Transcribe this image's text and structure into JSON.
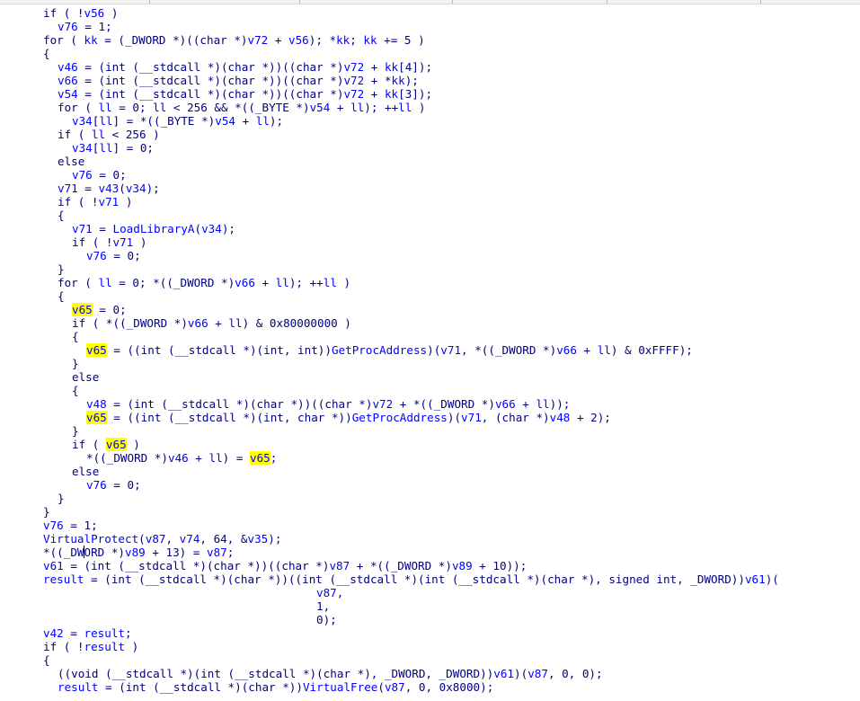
{
  "editor": {
    "lines": [
      [
        {
          "t": "if ( !",
          "c": "k"
        },
        {
          "t": "v56",
          "c": "v"
        },
        {
          "t": " )",
          "c": "s"
        }
      ],
      [
        {
          "t": "v76",
          "c": "v"
        },
        {
          "t": " = 1;",
          "c": "s"
        }
      ],
      [
        {
          "t": "for ( ",
          "c": "k"
        },
        {
          "t": "kk",
          "c": "v"
        },
        {
          "t": " = (_DWORD *)((char *)",
          "c": "s"
        },
        {
          "t": "v72",
          "c": "v"
        },
        {
          "t": " + ",
          "c": "s"
        },
        {
          "t": "v56",
          "c": "v"
        },
        {
          "t": "); *",
          "c": "s"
        },
        {
          "t": "kk",
          "c": "v"
        },
        {
          "t": "; ",
          "c": "s"
        },
        {
          "t": "kk",
          "c": "v"
        },
        {
          "t": " += 5 )",
          "c": "s"
        }
      ],
      [
        {
          "t": "{",
          "c": "s"
        }
      ],
      [
        {
          "t": "v46",
          "c": "v"
        },
        {
          "t": " = (int (__stdcall *)(char *))((char *)",
          "c": "s"
        },
        {
          "t": "v72",
          "c": "v"
        },
        {
          "t": " + ",
          "c": "s"
        },
        {
          "t": "kk",
          "c": "v"
        },
        {
          "t": "[4]);",
          "c": "s"
        }
      ],
      [
        {
          "t": "v66",
          "c": "v"
        },
        {
          "t": " = (int (__stdcall *)(char *))((char *)",
          "c": "s"
        },
        {
          "t": "v72",
          "c": "v"
        },
        {
          "t": " + *",
          "c": "s"
        },
        {
          "t": "kk",
          "c": "v"
        },
        {
          "t": ");",
          "c": "s"
        }
      ],
      [
        {
          "t": "v54",
          "c": "v"
        },
        {
          "t": " = (int (__stdcall *)(char *))((char *)",
          "c": "s"
        },
        {
          "t": "v72",
          "c": "v"
        },
        {
          "t": " + ",
          "c": "s"
        },
        {
          "t": "kk",
          "c": "v"
        },
        {
          "t": "[3]);",
          "c": "s"
        }
      ],
      [
        {
          "t": "for ( ",
          "c": "k"
        },
        {
          "t": "ll",
          "c": "v"
        },
        {
          "t": " = 0; ",
          "c": "s"
        },
        {
          "t": "ll",
          "c": "v"
        },
        {
          "t": " < 256 && *((_BYTE *)",
          "c": "s"
        },
        {
          "t": "v54",
          "c": "v"
        },
        {
          "t": " + ",
          "c": "s"
        },
        {
          "t": "ll",
          "c": "v"
        },
        {
          "t": "); ++",
          "c": "s"
        },
        {
          "t": "ll",
          "c": "v"
        },
        {
          "t": " )",
          "c": "s"
        }
      ],
      [
        {
          "t": "v34",
          "c": "v"
        },
        {
          "t": "[",
          "c": "s"
        },
        {
          "t": "ll",
          "c": "v"
        },
        {
          "t": "] = *((_BYTE *)",
          "c": "s"
        },
        {
          "t": "v54",
          "c": "v"
        },
        {
          "t": " + ",
          "c": "s"
        },
        {
          "t": "ll",
          "c": "v"
        },
        {
          "t": ");",
          "c": "s"
        }
      ],
      [
        {
          "t": "if ( ",
          "c": "k"
        },
        {
          "t": "ll",
          "c": "v"
        },
        {
          "t": " < 256 )",
          "c": "s"
        }
      ],
      [
        {
          "t": "v34",
          "c": "v"
        },
        {
          "t": "[",
          "c": "s"
        },
        {
          "t": "ll",
          "c": "v"
        },
        {
          "t": "] = 0;",
          "c": "s"
        }
      ],
      [
        {
          "t": "else",
          "c": "k"
        }
      ],
      [
        {
          "t": "v76",
          "c": "v"
        },
        {
          "t": " = 0;",
          "c": "s"
        }
      ],
      [
        {
          "t": "v71",
          "c": "v"
        },
        {
          "t": " = ",
          "c": "s"
        },
        {
          "t": "v43",
          "c": "v"
        },
        {
          "t": "(",
          "c": "s"
        },
        {
          "t": "v34",
          "c": "v"
        },
        {
          "t": ");",
          "c": "s"
        }
      ],
      [
        {
          "t": "if ( !",
          "c": "k"
        },
        {
          "t": "v71",
          "c": "v"
        },
        {
          "t": " )",
          "c": "s"
        }
      ],
      [
        {
          "t": "{",
          "c": "s"
        }
      ],
      [
        {
          "t": "v71",
          "c": "v"
        },
        {
          "t": " = ",
          "c": "s"
        },
        {
          "t": "LoadLibraryA",
          "c": "v"
        },
        {
          "t": "(",
          "c": "s"
        },
        {
          "t": "v34",
          "c": "v"
        },
        {
          "t": ");",
          "c": "s"
        }
      ],
      [
        {
          "t": "if ( !",
          "c": "k"
        },
        {
          "t": "v71",
          "c": "v"
        },
        {
          "t": " )",
          "c": "s"
        }
      ],
      [
        {
          "t": "v76",
          "c": "v"
        },
        {
          "t": " = 0;",
          "c": "s"
        }
      ],
      [
        {
          "t": "}",
          "c": "s"
        }
      ],
      [
        {
          "t": "for ( ",
          "c": "k"
        },
        {
          "t": "ll",
          "c": "v"
        },
        {
          "t": " = 0; *((_DWORD *)",
          "c": "s"
        },
        {
          "t": "v66",
          "c": "v"
        },
        {
          "t": " + ",
          "c": "s"
        },
        {
          "t": "ll",
          "c": "v"
        },
        {
          "t": "); ++",
          "c": "s"
        },
        {
          "t": "ll",
          "c": "v"
        },
        {
          "t": " )",
          "c": "s"
        }
      ],
      [
        {
          "t": "{",
          "c": "s"
        }
      ],
      [
        {
          "t": "v65",
          "c": "v",
          "hl": true
        },
        {
          "t": " = 0;",
          "c": "s"
        }
      ],
      [
        {
          "t": "if ( *((_DWORD *)",
          "c": "k"
        },
        {
          "t": "v66",
          "c": "v"
        },
        {
          "t": " + ",
          "c": "s"
        },
        {
          "t": "ll",
          "c": "v"
        },
        {
          "t": ") & 0x80000000 )",
          "c": "s"
        }
      ],
      [
        {
          "t": "{",
          "c": "s"
        }
      ],
      [
        {
          "t": "v65",
          "c": "v",
          "hl": true
        },
        {
          "t": " = ((int (__stdcall *)(int, int))",
          "c": "s"
        },
        {
          "t": "GetProcAddress",
          "c": "v"
        },
        {
          "t": ")(",
          "c": "s"
        },
        {
          "t": "v71",
          "c": "v"
        },
        {
          "t": ", *((_DWORD *)",
          "c": "s"
        },
        {
          "t": "v66",
          "c": "v"
        },
        {
          "t": " + ",
          "c": "s"
        },
        {
          "t": "ll",
          "c": "v"
        },
        {
          "t": ") & 0xFFFF);",
          "c": "s"
        }
      ],
      [
        {
          "t": "}",
          "c": "s"
        }
      ],
      [
        {
          "t": "else",
          "c": "k"
        }
      ],
      [
        {
          "t": "{",
          "c": "s"
        }
      ],
      [
        {
          "t": "v48",
          "c": "v"
        },
        {
          "t": " = (int (__stdcall *)(char *))((char *)",
          "c": "s"
        },
        {
          "t": "v72",
          "c": "v"
        },
        {
          "t": " + *((_DWORD *)",
          "c": "s"
        },
        {
          "t": "v66",
          "c": "v"
        },
        {
          "t": " + ",
          "c": "s"
        },
        {
          "t": "ll",
          "c": "v"
        },
        {
          "t": "));",
          "c": "s"
        }
      ],
      [
        {
          "t": "v65",
          "c": "v",
          "hl": true
        },
        {
          "t": " = ((int (__stdcall *)(int, char *))",
          "c": "s"
        },
        {
          "t": "GetProcAddress",
          "c": "v"
        },
        {
          "t": ")(",
          "c": "s"
        },
        {
          "t": "v71",
          "c": "v"
        },
        {
          "t": ", (char *)",
          "c": "s"
        },
        {
          "t": "v48",
          "c": "v"
        },
        {
          "t": " + 2);",
          "c": "s"
        }
      ],
      [
        {
          "t": "}",
          "c": "s"
        }
      ],
      [
        {
          "t": "if ( ",
          "c": "k"
        },
        {
          "t": "v65",
          "c": "v",
          "hl": true
        },
        {
          "t": " )",
          "c": "s"
        }
      ],
      [
        {
          "t": "*((_DWORD *)",
          "c": "s"
        },
        {
          "t": "v46",
          "c": "v"
        },
        {
          "t": " + ",
          "c": "s"
        },
        {
          "t": "ll",
          "c": "v"
        },
        {
          "t": ") = ",
          "c": "s"
        },
        {
          "t": "v65",
          "c": "v",
          "hl": true
        },
        {
          "t": ";",
          "c": "s"
        }
      ],
      [
        {
          "t": "else",
          "c": "k"
        }
      ],
      [
        {
          "t": "v76",
          "c": "v"
        },
        {
          "t": " = 0;",
          "c": "s"
        }
      ],
      [
        {
          "t": "}",
          "c": "s"
        }
      ],
      [
        {
          "t": "}",
          "c": "s"
        }
      ],
      [
        {
          "t": "v76",
          "c": "v"
        },
        {
          "t": " = 1;",
          "c": "s"
        }
      ],
      [
        {
          "t": "VirtualProtect",
          "c": "v"
        },
        {
          "t": "(",
          "c": "s"
        },
        {
          "t": "v87",
          "c": "v"
        },
        {
          "t": ", ",
          "c": "s"
        },
        {
          "t": "v74",
          "c": "v"
        },
        {
          "t": ", 64, &",
          "c": "s"
        },
        {
          "t": "v35",
          "c": "v"
        },
        {
          "t": ");",
          "c": "s"
        }
      ],
      [
        {
          "t": "*((_DWORD *)",
          "c": "s"
        },
        {
          "t": "v89",
          "c": "v"
        },
        {
          "t": " + 13) = ",
          "c": "s"
        },
        {
          "t": "v87",
          "c": "v"
        },
        {
          "t": ";",
          "c": "s"
        }
      ],
      [
        {
          "t": "v61",
          "c": "v"
        },
        {
          "t": " = (int (__stdcall *)(char *))((char *)",
          "c": "s"
        },
        {
          "t": "v87",
          "c": "v"
        },
        {
          "t": " + *((_DWORD *)",
          "c": "s"
        },
        {
          "t": "v89",
          "c": "v"
        },
        {
          "t": " + 10));",
          "c": "s"
        }
      ],
      [
        {
          "t": "result",
          "c": "v"
        },
        {
          "t": " = (int (__stdcall *)(char *))((int (__stdcall *)(int (__stdcall *)(char *), signed int, _DWORD))",
          "c": "s"
        },
        {
          "t": "v61",
          "c": "v"
        },
        {
          "t": ")(",
          "c": "s"
        }
      ],
      [
        {
          "t": "v87",
          "c": "v"
        },
        {
          "t": ",",
          "c": "s"
        }
      ],
      [
        {
          "t": "1,",
          "c": "s"
        }
      ],
      [
        {
          "t": "0);",
          "c": "s"
        }
      ],
      [
        {
          "t": "v42",
          "c": "v"
        },
        {
          "t": " = ",
          "c": "s"
        },
        {
          "t": "result",
          "c": "v"
        },
        {
          "t": ";",
          "c": "s"
        }
      ],
      [
        {
          "t": "if ( !",
          "c": "k"
        },
        {
          "t": "result",
          "c": "v"
        },
        {
          "t": " )",
          "c": "s"
        }
      ],
      [
        {
          "t": "{",
          "c": "s"
        }
      ],
      [
        {
          "t": "((void (__stdcall *)(int (__stdcall *)(char *), _DWORD, _DWORD))",
          "c": "s"
        },
        {
          "t": "v61",
          "c": "v"
        },
        {
          "t": ")(",
          "c": "s"
        },
        {
          "t": "v87",
          "c": "v"
        },
        {
          "t": ", 0, 0);",
          "c": "s"
        }
      ],
      [
        {
          "t": "result",
          "c": "v"
        },
        {
          "t": " = (int (__stdcall *)(char *))",
          "c": "s"
        },
        {
          "t": "VirtualFree",
          "c": "v"
        },
        {
          "t": "(",
          "c": "s"
        },
        {
          "t": "v87",
          "c": "v"
        },
        {
          "t": ", 0, 0x8000);",
          "c": "s"
        }
      ]
    ]
  }
}
